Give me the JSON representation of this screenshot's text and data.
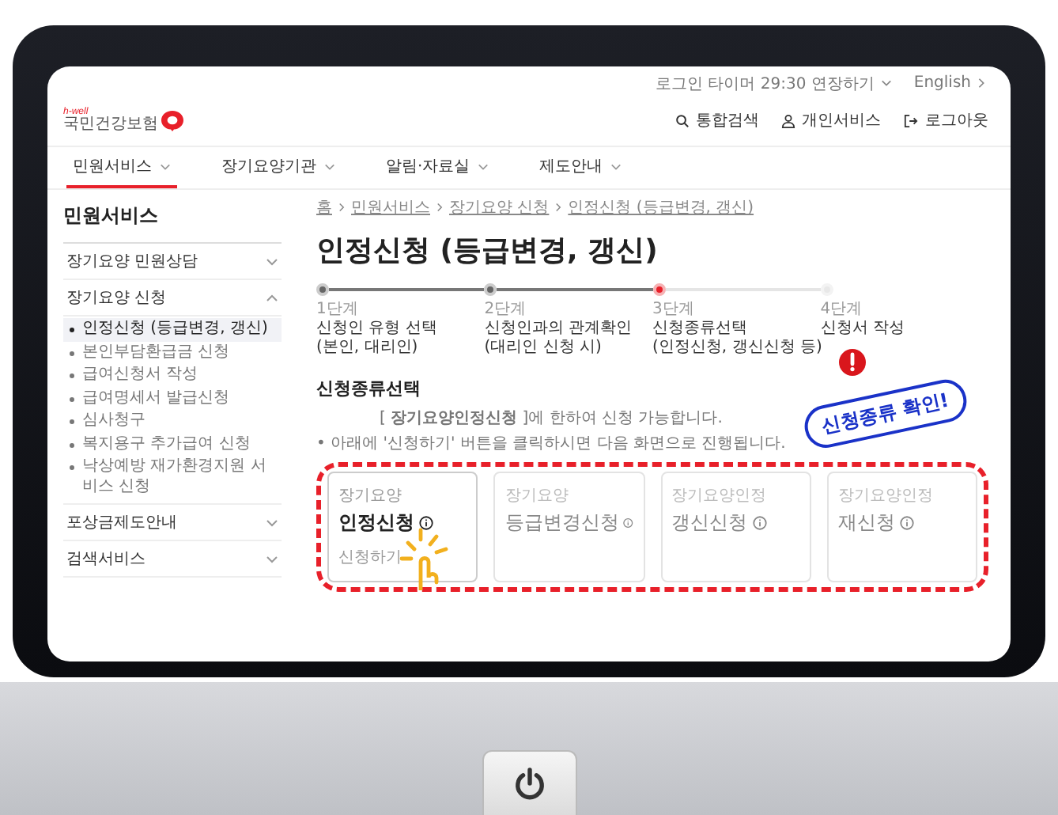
{
  "top_bar": {
    "login_timer": "로그인 타이머 29:30 연장하기",
    "language": "English"
  },
  "logo": {
    "tagline": "h-well",
    "name": "국민건강보험"
  },
  "header_actions": [
    {
      "label": "통합검색",
      "kind": "search"
    },
    {
      "label": "개인서비스",
      "kind": "person"
    },
    {
      "label": "로그아웃",
      "kind": "logout"
    }
  ],
  "nav": [
    {
      "label": "민원서비스",
      "selected": true
    },
    {
      "label": "장기요양기관",
      "selected": false
    },
    {
      "label": "알림·자료실",
      "selected": false
    },
    {
      "label": "제도안내",
      "selected": false
    }
  ],
  "sidebar": {
    "title": "민원서비스",
    "items": [
      {
        "label": "장기요양 민원상담",
        "expanded": false
      },
      {
        "label": "장기요양 신청",
        "expanded": true,
        "children": [
          {
            "label": "인정신청 (등급변경, 갱신)",
            "selected": true
          },
          {
            "label": "본인부담환급금 신청",
            "selected": false
          },
          {
            "label": "급여신청서 작성",
            "selected": false
          },
          {
            "label": "급여명세서 발급신청",
            "selected": false
          },
          {
            "label": "심사청구",
            "selected": false
          },
          {
            "label": "복지용구 추가급여 신청",
            "selected": false
          },
          {
            "label": "낙상예방 재가환경지원 서비스 신청",
            "selected": false
          }
        ]
      },
      {
        "label": "포상금제도안내",
        "expanded": false
      },
      {
        "label": "검색서비스",
        "expanded": false
      }
    ]
  },
  "breadcrumb": [
    "홈",
    "민원서비스",
    "장기요양 신청",
    "인정신청 (등급변경, 갱신)"
  ],
  "page_title": "인정신청 (등급변경, 갱신)",
  "steps": [
    {
      "step": "1단계",
      "label": "신청인 유형 선택",
      "note": "(본인, 대리인)",
      "done": true,
      "current": false
    },
    {
      "step": "2단계",
      "label": "신청인과의 관계확인",
      "note": "(대리인 신청 시)",
      "done": true,
      "current": false
    },
    {
      "step": "3단계",
      "label": "신청종류선택",
      "note": "(인정신청, 갱신신청 등)",
      "done": false,
      "current": true
    },
    {
      "step": "4단계",
      "label": "신청서 작성",
      "done": false,
      "current": false
    }
  ],
  "section_title": "신청종류선택",
  "notices": [
    "[ **장기요양인정신청** ]에 한하여 신청 가능합니다.",
    "• 아래에 '신청하기' 버튼을 클릭하시면 다음 화면으로 진행됩니다."
  ],
  "cards": [
    {
      "category": "장기요양",
      "title": "인정신청",
      "action": "신청하기",
      "disabled": false
    },
    {
      "category": "장기요양",
      "title": "등급변경신청",
      "disabled": true
    },
    {
      "category": "장기요양인정",
      "title": "갱신신청",
      "disabled": true
    },
    {
      "category": "장기요양인정",
      "title": "재신청",
      "disabled": true
    }
  ],
  "callout": "신청종류 확인!"
}
